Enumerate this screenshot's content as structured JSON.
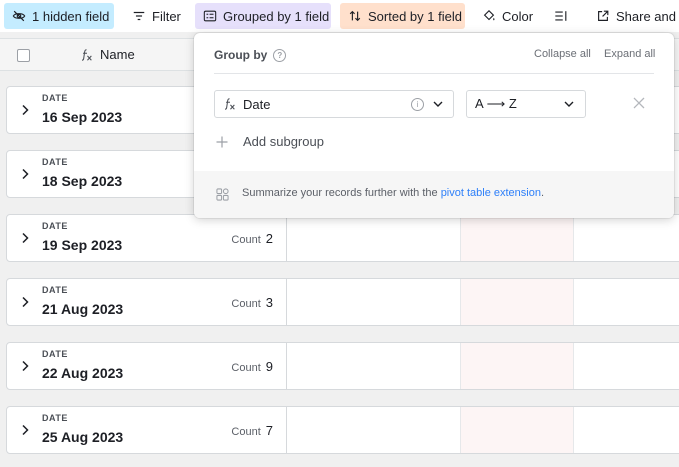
{
  "toolbar": {
    "hidden_fields": "1 hidden field",
    "filter": "Filter",
    "grouped": "Grouped by 1 field",
    "sorted": "Sorted by 1 field",
    "color": "Color",
    "share": "Share and sync"
  },
  "header": {
    "name_column": "Name"
  },
  "groups": [
    {
      "field": "DATE",
      "value": "16 Sep 2023",
      "count_label": "",
      "count": ""
    },
    {
      "field": "DATE",
      "value": "18 Sep 2023",
      "count_label": "",
      "count": ""
    },
    {
      "field": "DATE",
      "value": "19 Sep 2023",
      "count_label": "Count",
      "count": "2"
    },
    {
      "field": "DATE",
      "value": "21 Aug 2023",
      "count_label": "Count",
      "count": "3"
    },
    {
      "field": "DATE",
      "value": "22 Aug 2023",
      "count_label": "Count",
      "count": "9"
    },
    {
      "field": "DATE",
      "value": "25 Aug 2023",
      "count_label": "Count",
      "count": "7"
    }
  ],
  "popover": {
    "title": "Group by",
    "collapse_all": "Collapse all",
    "expand_all": "Expand all",
    "field": "Date",
    "order": "A ⟶ Z",
    "add_subgroup": "Add subgroup",
    "summary_text": "Summarize your records further with the ",
    "summary_link": "pivot table extension",
    "summary_end": "."
  },
  "colors": {
    "hidden_fields_bg": "#c4ecff",
    "grouped_bg": "#e6e0fb",
    "sorted_bg": "#ffe0cc",
    "link": "#2d7ff9"
  },
  "icons": {
    "hidden": "eye-slash-icon",
    "filter": "filter-icon",
    "group": "group-list-icon",
    "sort": "sort-arrows-icon",
    "color": "paint-bucket-icon",
    "density": "row-height-icon",
    "share": "external-link-icon",
    "formula": "formula-fx-icon",
    "expand": "chevron-right-icon"
  }
}
